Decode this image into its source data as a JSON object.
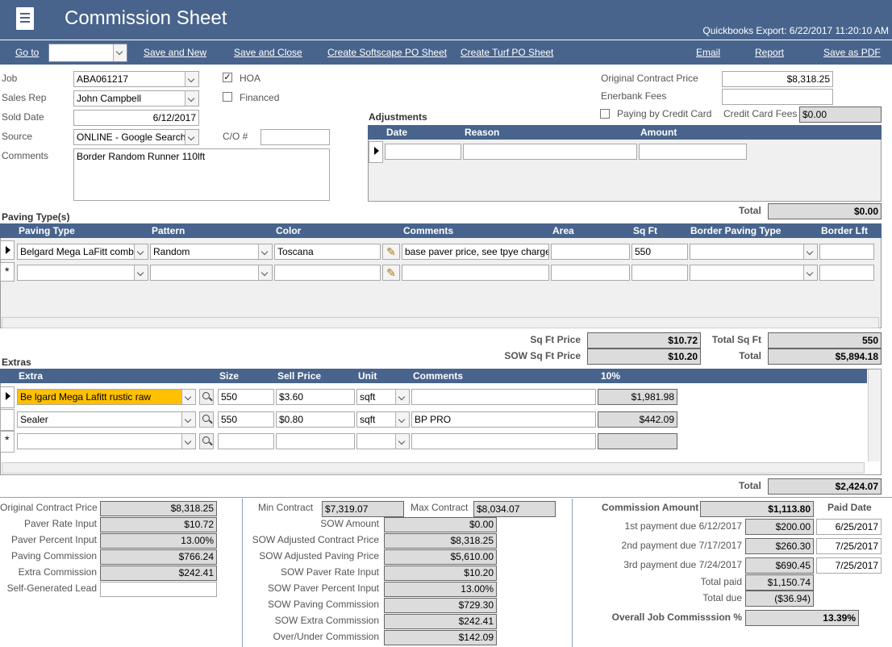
{
  "header": {
    "title": "Commission Sheet",
    "qb_export": "Quickbooks Export: 6/22/2017 11:20:10 AM"
  },
  "toolbar": {
    "goto": "Go to",
    "save_new": "Save and New",
    "save_close": "Save and Close",
    "softscape": "Create Softscape PO Sheet",
    "turf": "Create Turf PO Sheet",
    "email": "Email",
    "report": "Report",
    "pdf": "Save as PDF"
  },
  "job": {
    "job_label": "Job",
    "job": "ABA061217",
    "rep_label": "Sales Rep",
    "rep": "John Campbell",
    "sold_label": "Sold Date",
    "sold": "6/12/2017",
    "source_label": "Source",
    "source": "ONLINE - Google Search",
    "comments_label": "Comments",
    "comments": "Border Random Runner 110lft",
    "hoa": "HOA",
    "financed": "Financed",
    "co_label": "C/O #"
  },
  "right": {
    "ocp_label": "Original Contract Price",
    "ocp": "$8,318.25",
    "ener_label": "Enerbank Fees",
    "cc_label": "Paying by Credit Card",
    "ccfee_label": "Credit Card Fees",
    "ccfee": "$0.00"
  },
  "adj": {
    "title": "Adjustments",
    "date": "Date",
    "reason": "Reason",
    "amount": "Amount",
    "total_label": "Total",
    "total": "$0.00"
  },
  "paving": {
    "title": "Paving Type(s)",
    "cols": [
      "Paving Type",
      "Pattern",
      "Color",
      "Comments",
      "Area",
      "Sq Ft",
      "Border Paving Type",
      "Border Lft"
    ],
    "row": {
      "type": "Belgard Mega LaFitt comb",
      "pattern": "Random",
      "color": "Toscana",
      "comments": "base paver price, see tpye charge",
      "sqft": "550"
    },
    "sqft_price_label": "Sq Ft Price",
    "sqft_price": "$10.72",
    "sow_sqft_label": "SOW Sq Ft Price",
    "sow_sqft": "$10.20",
    "total_sqft_label": "Total Sq Ft",
    "total_sqft": "550",
    "total_label": "Total",
    "total": "$5,894.18"
  },
  "extras": {
    "title": "Extras",
    "cols": [
      "Extra",
      "Size",
      "Sell Price",
      "Unit",
      "Comments",
      "10%"
    ],
    "rows": [
      {
        "extra": "Be lgard Mega Lafitt rustic raw",
        "size": "550",
        "price": "$3.60",
        "unit": "sqft",
        "comments": "",
        "pct": "$1,981.98"
      },
      {
        "extra": "Sealer",
        "size": "550",
        "price": "$0.80",
        "unit": "sqft",
        "comments": "BP PRO",
        "pct": "$442.09"
      }
    ],
    "total_label": "Total",
    "total": "$2,424.07"
  },
  "bottom": {
    "left": [
      [
        "Original Contract Price",
        "$8,318.25"
      ],
      [
        "Paver Rate Input",
        "$10.72"
      ],
      [
        "Paver Percent Input",
        "13.00%"
      ],
      [
        "Paving Commission",
        "$766.24"
      ],
      [
        "Extra Commission",
        "$242.41"
      ],
      [
        "Self-Generated Lead",
        ""
      ]
    ],
    "min_label": "Min Contract",
    "min": "$7,319.07",
    "max_label": "Max Contract",
    "max": "$8,034.07",
    "mid": [
      [
        "SOW Amount",
        "$0.00"
      ],
      [
        "SOW Adjusted Contract Price",
        "$8,318.25"
      ],
      [
        "SOW Adjusted Paving Price",
        "$5,610.00"
      ],
      [
        "SOW Paver Rate Input",
        "$10.20"
      ],
      [
        "SOW Paver Percent Input",
        "13.00%"
      ],
      [
        "SOW Paving Commission",
        "$729.30"
      ],
      [
        "SOW Extra Commission",
        "$242.41"
      ],
      [
        "Over/Under Commission",
        "$142.09"
      ]
    ],
    "comm_label": "Commission Amount",
    "comm": "$1,113.80",
    "paid_label": "Paid Date",
    "payments": [
      [
        "1st payment due 6/12/2017",
        "$200.00",
        "6/25/2017"
      ],
      [
        "2nd payment due 7/17/2017",
        "$260.30",
        "7/25/2017"
      ],
      [
        "3rd payment due 7/24/2017",
        "$690.45",
        "7/25/2017"
      ]
    ],
    "tpaid_label": "Total paid",
    "tpaid": "$1,150.74",
    "tdue_label": "Total due",
    "tdue": "($36.94)",
    "overall_label": "Overall Job Commisssion %",
    "overall": "13.39%"
  }
}
